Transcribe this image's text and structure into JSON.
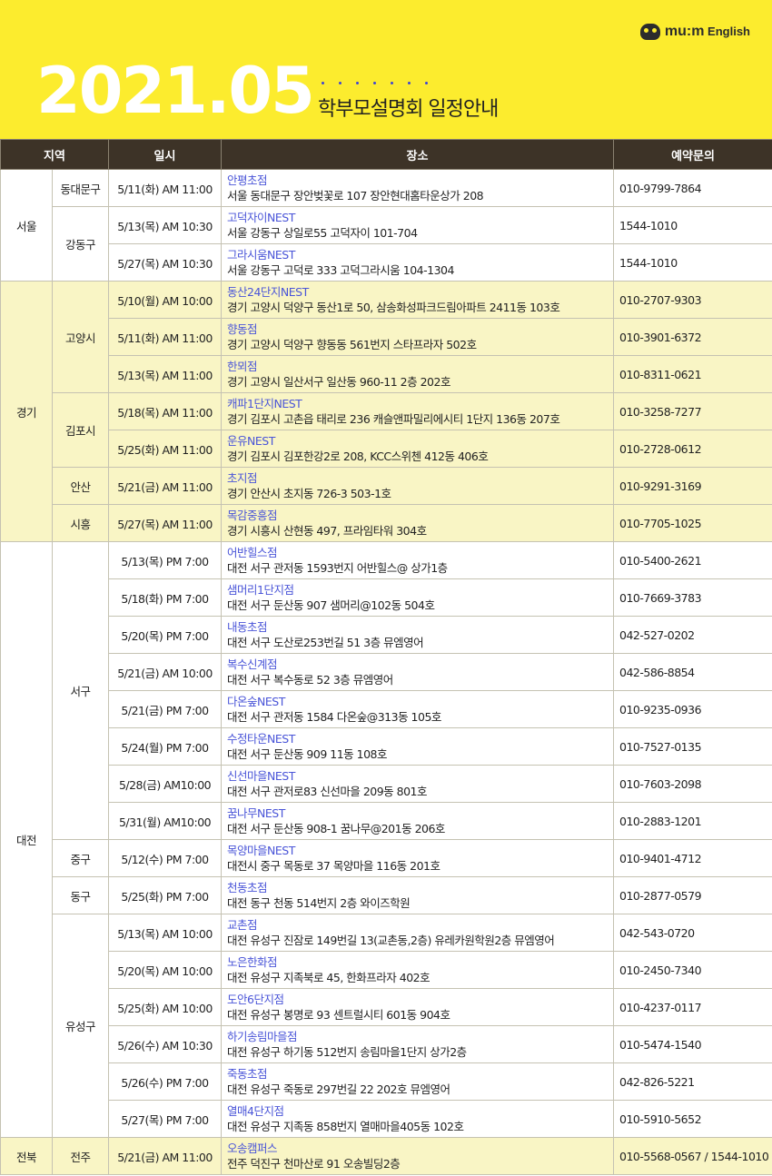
{
  "brand": {
    "logo_main": "mu:m",
    "logo_sub": "English"
  },
  "header": {
    "year": "2021.05",
    "subtitle": "학부모설명회 일정안내"
  },
  "table": {
    "headers": [
      "지역",
      "일시",
      "장소",
      "예약문의"
    ],
    "regions": [
      {
        "name": "서울",
        "highlight": false,
        "districts": [
          {
            "name": "동대문구",
            "rows": [
              {
                "date": "5/11(화) AM 11:00",
                "branch": "안평초점",
                "address": "서울 동대문구 장안벚꽃로 107 장안현대홈타운상가 208",
                "phone": "010-9799-7864"
              }
            ]
          },
          {
            "name": "강동구",
            "rows": [
              {
                "date": "5/13(목) AM 10:30",
                "branch": "고덕자이NEST",
                "address": "서울 강동구 상일로55 고덕자이 101-704",
                "phone": "1544-1010"
              },
              {
                "date": "5/27(목) AM 10:30",
                "branch": "그라시움NEST",
                "address": "서울 강동구 고덕로 333 고덕그라시움 104-1304",
                "phone": "1544-1010"
              }
            ]
          }
        ]
      },
      {
        "name": "경기",
        "highlight": true,
        "districts": [
          {
            "name": "고양시",
            "rows": [
              {
                "date": "5/10(월) AM 10:00",
                "branch": "동산24단지NEST",
                "address": "경기 고양시 덕양구 동산1로 50, 삼송화성파크드림아파트 2411동 103호",
                "phone": "010-2707-9303"
              },
              {
                "date": "5/11(화) AM 11:00",
                "branch": "향동점",
                "address": "경기 고양시 덕양구 향동동 561번지 스타프라자  502호",
                "phone": "010-3901-6372"
              },
              {
                "date": "5/13(목) AM 11:00",
                "branch": "한뫼점",
                "address": "경기 고양시 일산서구 일산동 960-11 2층 202호",
                "phone": "010-8311-0621"
              }
            ]
          },
          {
            "name": "김포시",
            "rows": [
              {
                "date": "5/18(목) AM 11:00",
                "branch": "캐파1단지NEST",
                "address": "경기 김포시 고촌읍 태리로 236 캐슬앤파밀리에시티 1단지 136동 207호",
                "phone": "010-3258-7277"
              },
              {
                "date": "5/25(화) AM 11:00",
                "branch": "운유NEST",
                "address": "경기 김포시 김포한강2로 208, KCC스위첸 412동 406호",
                "phone": "010-2728-0612"
              }
            ]
          },
          {
            "name": "안산",
            "rows": [
              {
                "date": "5/21(금) AM 11:00",
                "branch": "초지점",
                "address": "경기 안산시 초지동 726-3 503-1호",
                "phone": "010-9291-3169"
              }
            ]
          },
          {
            "name": "시흥",
            "rows": [
              {
                "date": "5/27(목) AM 11:00",
                "branch": "목감중흥점",
                "address": "경기 시흥시 산현동 497, 프라임타워 304호",
                "phone": "010-7705-1025"
              }
            ]
          }
        ]
      },
      {
        "name": "대전",
        "highlight": false,
        "districts": [
          {
            "name": "서구",
            "rows": [
              {
                "date": "5/13(목) PM 7:00",
                "branch": "어반힐스점",
                "address": "대전 서구 관저동 1593번지 어반힐스@ 상가1층",
                "phone": "010-5400-2621"
              },
              {
                "date": "5/18(화) PM 7:00",
                "branch": "샘머리1단지점",
                "address": "대전 서구 둔산동 907 샘머리@102동 504호",
                "phone": "010-7669-3783"
              },
              {
                "date": "5/20(목) PM 7:00",
                "branch": "내동초점",
                "address": "대전 서구 도산로253번길 51 3층 뮤엠영어",
                "phone": "042-527-0202"
              },
              {
                "date": "5/21(금) AM 10:00",
                "branch": "복수신계점",
                "address": "대전 서구 복수동로 52 3층 뮤엠영어",
                "phone": "042-586-8854"
              },
              {
                "date": "5/21(금) PM 7:00",
                "branch": "다온숲NEST",
                "address": "대전 서구 관저동 1584 다온숲@313동 105호",
                "phone": "010-9235-0936"
              },
              {
                "date": "5/24(월) PM 7:00",
                "branch": "수정타운NEST",
                "address": "대전 서구 둔산동 909 11동 108호",
                "phone": "010-7527-0135"
              },
              {
                "date": "5/28(금) AM10:00",
                "branch": "신선마을NEST",
                "address": "대전 서구 관저로83 신선마을 209동 801호",
                "phone": "010-7603-2098"
              },
              {
                "date": "5/31(월) AM10:00",
                "branch": "꿈나무NEST",
                "address": "대전 서구 둔산동 908-1 꿈나무@201동 206호",
                "phone": "010-2883-1201"
              }
            ]
          },
          {
            "name": "중구",
            "rows": [
              {
                "date": "5/12(수) PM 7:00",
                "branch": "목양마을NEST",
                "address": "대전시 중구 목동로 37 목양마을 116동 201호",
                "phone": "010-9401-4712"
              }
            ]
          },
          {
            "name": "동구",
            "rows": [
              {
                "date": "5/25(화) PM 7:00",
                "branch": "천동초점",
                "address": "대전 동구 천동 514번지 2층 와이즈학원",
                "phone": "010-2877-0579"
              }
            ]
          },
          {
            "name": "유성구",
            "rows": [
              {
                "date": "5/13(목) AM 10:00",
                "branch": "교촌점",
                "address": "대전 유성구 진잠로 149번길 13(교촌동,2층) 유레카원학원2층 뮤엠영어",
                "phone": "042-543-0720"
              },
              {
                "date": "5/20(목) AM 10:00",
                "branch": "노은한화점",
                "address": "대전 유성구 지족북로 45, 한화프라자 402호",
                "phone": "010-2450-7340"
              },
              {
                "date": "5/25(화) AM 10:00",
                "branch": "도안6단지점",
                "address": "대전 유성구 봉명로 93 센트럴시티 601동 904호",
                "phone": "010-4237-0117"
              },
              {
                "date": "5/26(수) AM 10:30",
                "branch": "하기송림마을점",
                "address": "대전 유성구 하기동 512번지 송림마을1단지 상가2층",
                "phone": "010-5474-1540"
              },
              {
                "date": "5/26(수) PM 7:00",
                "branch": "죽동초점",
                "address": "대전 유성구 죽동로 297번길 22 202호 뮤엠영어",
                "phone": "042-826-5221"
              },
              {
                "date": "5/27(목) PM 7:00",
                "branch": "열매4단지점",
                "address": "대전 유성구 지족동 858번지 열매마을405동 102호",
                "phone": "010-5910-5652"
              }
            ]
          }
        ]
      },
      {
        "name": "전북",
        "highlight": true,
        "districts": [
          {
            "name": "전주",
            "rows": [
              {
                "date": "5/21(금) AM 11:00",
                "branch": "오송캠퍼스",
                "address": "전주 덕진구 천마산로 91 오송빌딩2층",
                "phone": "010-5568-0567 / 1544-1010"
              }
            ]
          }
        ]
      }
    ]
  }
}
